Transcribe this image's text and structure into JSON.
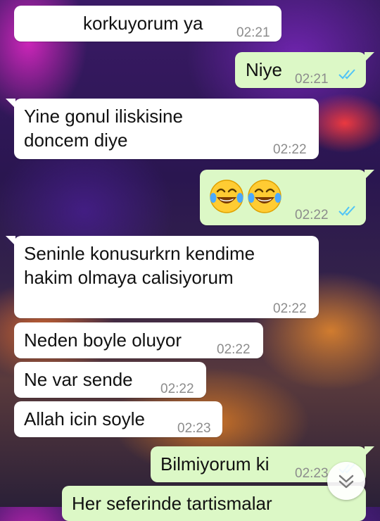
{
  "messages": [
    {
      "direction": "incoming",
      "text": "korkuyorum ya",
      "time": "02:21"
    },
    {
      "direction": "outgoing",
      "text": "Niye",
      "time": "02:21",
      "status": "read"
    },
    {
      "direction": "incoming",
      "lines": [
        "Yine gonul iliskisine",
        "doncem diye"
      ],
      "time": "02:22"
    },
    {
      "direction": "outgoing",
      "emojis": [
        "face-with-tears-of-joy",
        "face-with-tears-of-joy"
      ],
      "time": "02:22",
      "status": "read"
    },
    {
      "direction": "incoming",
      "lines": [
        "Seninle konusurkrn kendime",
        "hakim olmaya calisiyorum"
      ],
      "time": "02:22"
    },
    {
      "direction": "incoming",
      "text": "Neden boyle oluyor",
      "time": "02:22"
    },
    {
      "direction": "incoming",
      "text": "Ne var sende",
      "time": "02:22"
    },
    {
      "direction": "incoming",
      "text": "Allah icin soyle",
      "time": "02:23"
    },
    {
      "direction": "outgoing",
      "text": "Bilmiyorum ki",
      "time": "02:23",
      "status": "read"
    },
    {
      "direction": "outgoing",
      "text": "Her seferinde tartismalar"
    }
  ],
  "colors": {
    "incoming_bubble": "#ffffff",
    "outgoing_bubble": "#dcf8c6",
    "read_tick": "#4fc3f7",
    "timestamp": "#8c8c8c"
  },
  "icons": {
    "read_receipt": "double-check-icon",
    "scroll_down": "chevron-double-down-icon",
    "emoji": "face-with-tears-of-joy"
  }
}
